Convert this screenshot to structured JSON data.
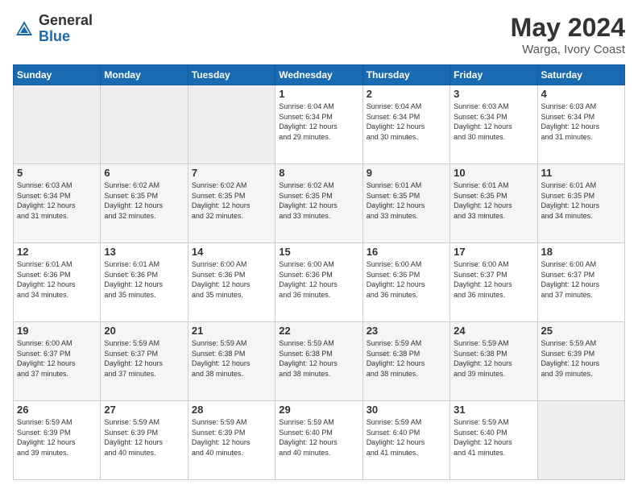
{
  "header": {
    "logo_general": "General",
    "logo_blue": "Blue",
    "month": "May 2024",
    "location": "Warga, Ivory Coast"
  },
  "days_of_week": [
    "Sunday",
    "Monday",
    "Tuesday",
    "Wednesday",
    "Thursday",
    "Friday",
    "Saturday"
  ],
  "weeks": [
    [
      {
        "day": "",
        "info": ""
      },
      {
        "day": "",
        "info": ""
      },
      {
        "day": "",
        "info": ""
      },
      {
        "day": "1",
        "info": "Sunrise: 6:04 AM\nSunset: 6:34 PM\nDaylight: 12 hours\nand 29 minutes."
      },
      {
        "day": "2",
        "info": "Sunrise: 6:04 AM\nSunset: 6:34 PM\nDaylight: 12 hours\nand 30 minutes."
      },
      {
        "day": "3",
        "info": "Sunrise: 6:03 AM\nSunset: 6:34 PM\nDaylight: 12 hours\nand 30 minutes."
      },
      {
        "day": "4",
        "info": "Sunrise: 6:03 AM\nSunset: 6:34 PM\nDaylight: 12 hours\nand 31 minutes."
      }
    ],
    [
      {
        "day": "5",
        "info": "Sunrise: 6:03 AM\nSunset: 6:34 PM\nDaylight: 12 hours\nand 31 minutes."
      },
      {
        "day": "6",
        "info": "Sunrise: 6:02 AM\nSunset: 6:35 PM\nDaylight: 12 hours\nand 32 minutes."
      },
      {
        "day": "7",
        "info": "Sunrise: 6:02 AM\nSunset: 6:35 PM\nDaylight: 12 hours\nand 32 minutes."
      },
      {
        "day": "8",
        "info": "Sunrise: 6:02 AM\nSunset: 6:35 PM\nDaylight: 12 hours\nand 33 minutes."
      },
      {
        "day": "9",
        "info": "Sunrise: 6:01 AM\nSunset: 6:35 PM\nDaylight: 12 hours\nand 33 minutes."
      },
      {
        "day": "10",
        "info": "Sunrise: 6:01 AM\nSunset: 6:35 PM\nDaylight: 12 hours\nand 33 minutes."
      },
      {
        "day": "11",
        "info": "Sunrise: 6:01 AM\nSunset: 6:35 PM\nDaylight: 12 hours\nand 34 minutes."
      }
    ],
    [
      {
        "day": "12",
        "info": "Sunrise: 6:01 AM\nSunset: 6:36 PM\nDaylight: 12 hours\nand 34 minutes."
      },
      {
        "day": "13",
        "info": "Sunrise: 6:01 AM\nSunset: 6:36 PM\nDaylight: 12 hours\nand 35 minutes."
      },
      {
        "day": "14",
        "info": "Sunrise: 6:00 AM\nSunset: 6:36 PM\nDaylight: 12 hours\nand 35 minutes."
      },
      {
        "day": "15",
        "info": "Sunrise: 6:00 AM\nSunset: 6:36 PM\nDaylight: 12 hours\nand 36 minutes."
      },
      {
        "day": "16",
        "info": "Sunrise: 6:00 AM\nSunset: 6:36 PM\nDaylight: 12 hours\nand 36 minutes."
      },
      {
        "day": "17",
        "info": "Sunrise: 6:00 AM\nSunset: 6:37 PM\nDaylight: 12 hours\nand 36 minutes."
      },
      {
        "day": "18",
        "info": "Sunrise: 6:00 AM\nSunset: 6:37 PM\nDaylight: 12 hours\nand 37 minutes."
      }
    ],
    [
      {
        "day": "19",
        "info": "Sunrise: 6:00 AM\nSunset: 6:37 PM\nDaylight: 12 hours\nand 37 minutes."
      },
      {
        "day": "20",
        "info": "Sunrise: 5:59 AM\nSunset: 6:37 PM\nDaylight: 12 hours\nand 37 minutes."
      },
      {
        "day": "21",
        "info": "Sunrise: 5:59 AM\nSunset: 6:38 PM\nDaylight: 12 hours\nand 38 minutes."
      },
      {
        "day": "22",
        "info": "Sunrise: 5:59 AM\nSunset: 6:38 PM\nDaylight: 12 hours\nand 38 minutes."
      },
      {
        "day": "23",
        "info": "Sunrise: 5:59 AM\nSunset: 6:38 PM\nDaylight: 12 hours\nand 38 minutes."
      },
      {
        "day": "24",
        "info": "Sunrise: 5:59 AM\nSunset: 6:38 PM\nDaylight: 12 hours\nand 39 minutes."
      },
      {
        "day": "25",
        "info": "Sunrise: 5:59 AM\nSunset: 6:39 PM\nDaylight: 12 hours\nand 39 minutes."
      }
    ],
    [
      {
        "day": "26",
        "info": "Sunrise: 5:59 AM\nSunset: 6:39 PM\nDaylight: 12 hours\nand 39 minutes."
      },
      {
        "day": "27",
        "info": "Sunrise: 5:59 AM\nSunset: 6:39 PM\nDaylight: 12 hours\nand 40 minutes."
      },
      {
        "day": "28",
        "info": "Sunrise: 5:59 AM\nSunset: 6:39 PM\nDaylight: 12 hours\nand 40 minutes."
      },
      {
        "day": "29",
        "info": "Sunrise: 5:59 AM\nSunset: 6:40 PM\nDaylight: 12 hours\nand 40 minutes."
      },
      {
        "day": "30",
        "info": "Sunrise: 5:59 AM\nSunset: 6:40 PM\nDaylight: 12 hours\nand 41 minutes."
      },
      {
        "day": "31",
        "info": "Sunrise: 5:59 AM\nSunset: 6:40 PM\nDaylight: 12 hours\nand 41 minutes."
      },
      {
        "day": "",
        "info": ""
      }
    ]
  ]
}
